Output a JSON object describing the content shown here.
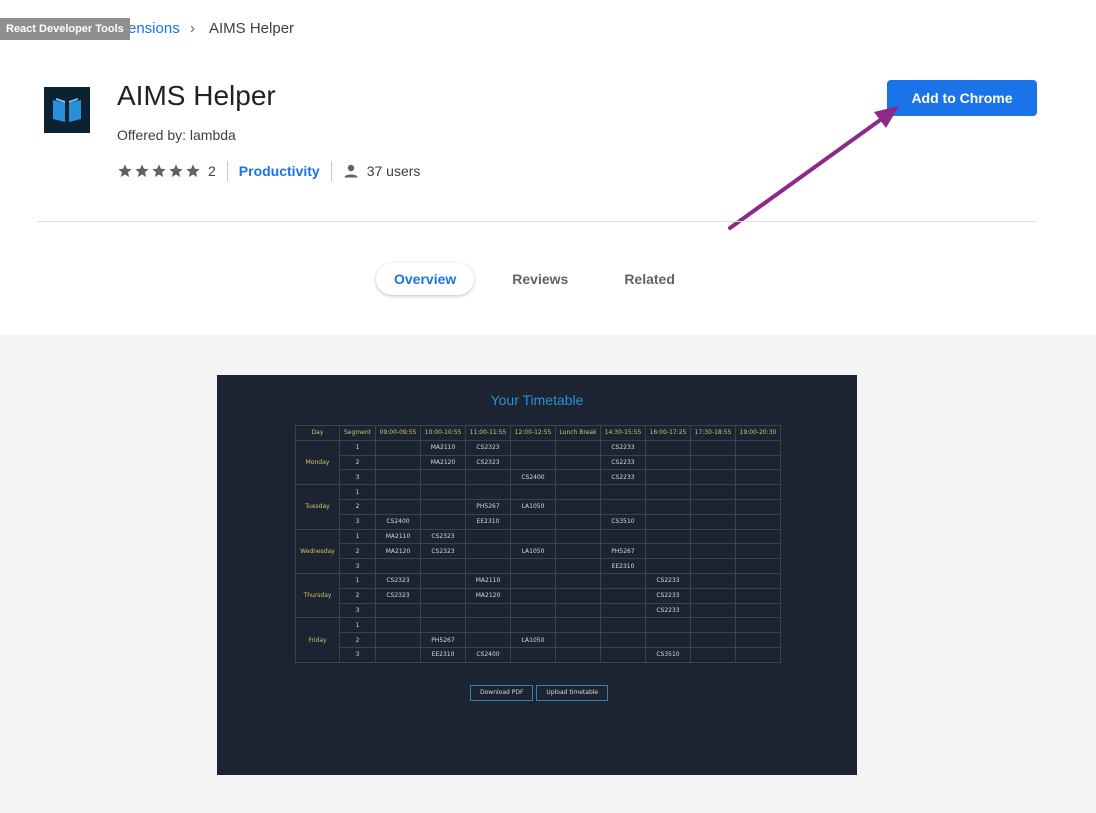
{
  "breadcrumb": {
    "devtools_tag": "React Developer Tools",
    "link": "ensions",
    "separator": "›",
    "current": "AIMS Helper"
  },
  "extension": {
    "title": "AIMS Helper",
    "offered_by": "Offered by: lambda",
    "rating_count": "2",
    "rating_stars": 5,
    "category": "Productivity",
    "users": "37 users",
    "icon": "book-icon"
  },
  "actions": {
    "add_button": "Add to Chrome"
  },
  "colors": {
    "accent": "#1a73e8",
    "annotation_arrow": "#8b2a8b"
  },
  "tabs": [
    {
      "label": "Overview",
      "active": true
    },
    {
      "label": "Reviews",
      "active": false
    },
    {
      "label": "Related",
      "active": false
    }
  ],
  "screenshot": {
    "title": "Your Timetable",
    "headers": [
      "Day",
      "Segment",
      "09:00-09:55",
      "10:00-10:55",
      "11:00-11:55",
      "12:00-12:55",
      "Lunch Break",
      "14:30-15:55",
      "16:00-17:25",
      "17:30-18:55",
      "19:00-20:30"
    ],
    "days": [
      {
        "day": "Monday",
        "rows": [
          [
            "1",
            "",
            "MA2110",
            "CS2323",
            "",
            "",
            "CS2233",
            "",
            "",
            ""
          ],
          [
            "2",
            "",
            "MA2120",
            "CS2323",
            "",
            "",
            "CS2233",
            "",
            "",
            ""
          ],
          [
            "3",
            "",
            "",
            "",
            "CS2400",
            "",
            "CS2233",
            "",
            "",
            ""
          ]
        ]
      },
      {
        "day": "Tuesday",
        "rows": [
          [
            "1",
            "",
            "",
            "",
            "",
            "",
            "",
            "",
            "",
            ""
          ],
          [
            "2",
            "",
            "",
            "PH5267",
            "LA1050",
            "",
            "",
            "",
            "",
            ""
          ],
          [
            "3",
            "CS2400",
            "",
            "EE2310",
            "",
            "",
            "CS3510",
            "",
            "",
            ""
          ]
        ]
      },
      {
        "day": "Wednesday",
        "rows": [
          [
            "1",
            "MA2110",
            "CS2323",
            "",
            "",
            "",
            "",
            "",
            "",
            ""
          ],
          [
            "2",
            "MA2120",
            "CS2323",
            "",
            "LA1050",
            "",
            "PH5267",
            "",
            "",
            ""
          ],
          [
            "3",
            "",
            "",
            "",
            "",
            "",
            "EE2310",
            "",
            "",
            ""
          ]
        ]
      },
      {
        "day": "Thursday",
        "rows": [
          [
            "1",
            "CS2323",
            "",
            "MA2110",
            "",
            "",
            "",
            "CS2233",
            "",
            ""
          ],
          [
            "2",
            "CS2323",
            "",
            "MA2120",
            "",
            "",
            "",
            "CS2233",
            "",
            ""
          ],
          [
            "3",
            "",
            "",
            "",
            "",
            "",
            "",
            "CS2233",
            "",
            ""
          ]
        ]
      },
      {
        "day": "Friday",
        "rows": [
          [
            "1",
            "",
            "",
            "",
            "",
            "",
            "",
            "",
            "",
            ""
          ],
          [
            "2",
            "",
            "PH5267",
            "",
            "LA1050",
            "",
            "",
            "",
            "",
            ""
          ],
          [
            "3",
            "",
            "EE2310",
            "CS2400",
            "",
            "",
            "",
            "CS3510",
            "",
            ""
          ]
        ]
      }
    ],
    "download_button": "Download PDF",
    "upload_button": "Upload timetable"
  }
}
